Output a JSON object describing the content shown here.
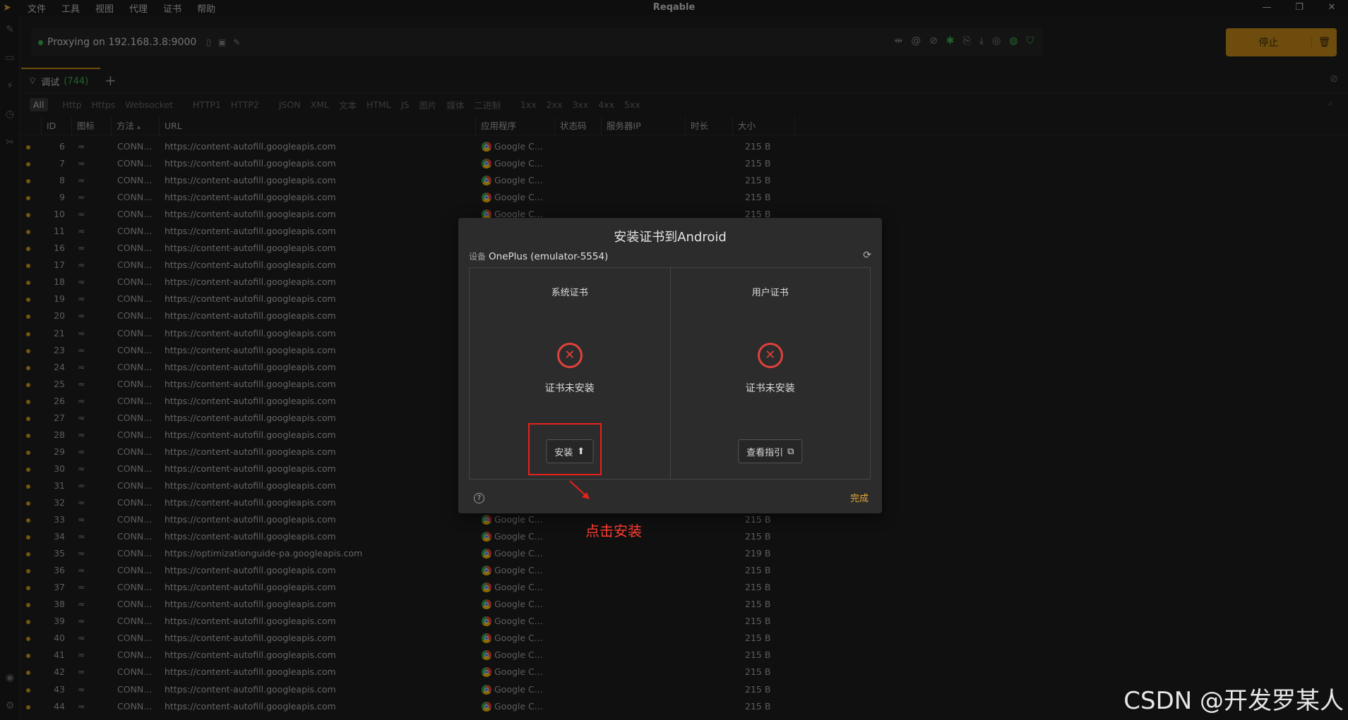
{
  "app": {
    "title": "Reqable",
    "menu": [
      "文件",
      "工具",
      "视图",
      "代理",
      "证书",
      "帮助"
    ]
  },
  "proxy": {
    "status": "Proxying on 192.168.3.8:9000",
    "stop_label": "停止"
  },
  "tabs": [
    {
      "label": "调试",
      "count": "(744)"
    }
  ],
  "filters": [
    "All",
    "Http",
    "Https",
    "Websocket",
    "HTTP1",
    "HTTP2",
    "JSON",
    "XML",
    "文本",
    "HTML",
    "JS",
    "图片",
    "媒体",
    "二进制",
    "1xx",
    "2xx",
    "3xx",
    "4xx",
    "5xx"
  ],
  "columns": {
    "id": "ID",
    "icon": "图标",
    "method": "方法",
    "url": "URL",
    "app": "应用程序",
    "status": "状态码",
    "server_ip": "服务器IP",
    "duration": "时长",
    "size": "大小"
  },
  "rows": [
    {
      "id": "6",
      "method": "CONN...",
      "url": "https://content-autofill.googleapis.com",
      "app": "Google C...",
      "size": "215 B"
    },
    {
      "id": "7",
      "method": "CONN...",
      "url": "https://content-autofill.googleapis.com",
      "app": "Google C...",
      "size": "215 B"
    },
    {
      "id": "8",
      "method": "CONN...",
      "url": "https://content-autofill.googleapis.com",
      "app": "Google C...",
      "size": "215 B"
    },
    {
      "id": "9",
      "method": "CONN...",
      "url": "https://content-autofill.googleapis.com",
      "app": "Google C...",
      "size": "215 B"
    },
    {
      "id": "10",
      "method": "CONN...",
      "url": "https://content-autofill.googleapis.com",
      "app": "Google C...",
      "size": "215 B"
    },
    {
      "id": "11",
      "method": "CONN...",
      "url": "https://content-autofill.googleapis.com",
      "app": "",
      "size": ""
    },
    {
      "id": "16",
      "method": "CONN...",
      "url": "https://content-autofill.googleapis.com",
      "app": "",
      "size": ""
    },
    {
      "id": "17",
      "method": "CONN...",
      "url": "https://content-autofill.googleapis.com",
      "app": "",
      "size": ""
    },
    {
      "id": "18",
      "method": "CONN...",
      "url": "https://content-autofill.googleapis.com",
      "app": "",
      "size": ""
    },
    {
      "id": "19",
      "method": "CONN...",
      "url": "https://content-autofill.googleapis.com",
      "app": "",
      "size": ""
    },
    {
      "id": "20",
      "method": "CONN...",
      "url": "https://content-autofill.googleapis.com",
      "app": "",
      "size": ""
    },
    {
      "id": "21",
      "method": "CONN...",
      "url": "https://content-autofill.googleapis.com",
      "app": "",
      "size": ""
    },
    {
      "id": "23",
      "method": "CONN...",
      "url": "https://content-autofill.googleapis.com",
      "app": "",
      "size": ""
    },
    {
      "id": "24",
      "method": "CONN...",
      "url": "https://content-autofill.googleapis.com",
      "app": "",
      "size": ""
    },
    {
      "id": "25",
      "method": "CONN...",
      "url": "https://content-autofill.googleapis.com",
      "app": "",
      "size": ""
    },
    {
      "id": "26",
      "method": "CONN...",
      "url": "https://content-autofill.googleapis.com",
      "app": "",
      "size": ""
    },
    {
      "id": "27",
      "method": "CONN...",
      "url": "https://content-autofill.googleapis.com",
      "app": "",
      "size": ""
    },
    {
      "id": "28",
      "method": "CONN...",
      "url": "https://content-autofill.googleapis.com",
      "app": "",
      "size": ""
    },
    {
      "id": "29",
      "method": "CONN...",
      "url": "https://content-autofill.googleapis.com",
      "app": "",
      "size": ""
    },
    {
      "id": "30",
      "method": "CONN...",
      "url": "https://content-autofill.googleapis.com",
      "app": "",
      "size": ""
    },
    {
      "id": "31",
      "method": "CONN...",
      "url": "https://content-autofill.googleapis.com",
      "app": "",
      "size": ""
    },
    {
      "id": "32",
      "method": "CONN...",
      "url": "https://content-autofill.googleapis.com",
      "app": "",
      "size": ""
    },
    {
      "id": "33",
      "method": "CONN...",
      "url": "https://content-autofill.googleapis.com",
      "app": "Google C...",
      "size": "215 B"
    },
    {
      "id": "34",
      "method": "CONN...",
      "url": "https://content-autofill.googleapis.com",
      "app": "Google C...",
      "size": "215 B"
    },
    {
      "id": "35",
      "method": "CONN...",
      "url": "https://optimizationguide-pa.googleapis.com",
      "app": "Google C...",
      "size": "219 B"
    },
    {
      "id": "36",
      "method": "CONN...",
      "url": "https://content-autofill.googleapis.com",
      "app": "Google C...",
      "size": "215 B"
    },
    {
      "id": "37",
      "method": "CONN...",
      "url": "https://content-autofill.googleapis.com",
      "app": "Google C...",
      "size": "215 B"
    },
    {
      "id": "38",
      "method": "CONN...",
      "url": "https://content-autofill.googleapis.com",
      "app": "Google C...",
      "size": "215 B"
    },
    {
      "id": "39",
      "method": "CONN...",
      "url": "https://content-autofill.googleapis.com",
      "app": "Google C...",
      "size": "215 B"
    },
    {
      "id": "40",
      "method": "CONN...",
      "url": "https://content-autofill.googleapis.com",
      "app": "Google C...",
      "size": "215 B"
    },
    {
      "id": "41",
      "method": "CONN...",
      "url": "https://content-autofill.googleapis.com",
      "app": "Google C...",
      "size": "215 B"
    },
    {
      "id": "42",
      "method": "CONN...",
      "url": "https://content-autofill.googleapis.com",
      "app": "Google C...",
      "size": "215 B"
    },
    {
      "id": "43",
      "method": "CONN...",
      "url": "https://content-autofill.googleapis.com",
      "app": "Google C...",
      "size": "215 B"
    },
    {
      "id": "44",
      "method": "CONN...",
      "url": "https://content-autofill.googleapis.com",
      "app": "Google C...",
      "size": "215 B"
    }
  ],
  "dialog": {
    "title": "安装证书到Android",
    "device_label": "设备",
    "device_name": "OnePlus (emulator-5554)",
    "system_cert": {
      "title": "系统证书",
      "status": "证书未安装",
      "button": "安装"
    },
    "user_cert": {
      "title": "用户证书",
      "status": "证书未安装",
      "button": "查看指引"
    },
    "done": "完成"
  },
  "annotation": {
    "callout": "点击安装"
  },
  "watermark": "CSDN @开发罗某人",
  "colors": {
    "accent": "#c98a1a",
    "status_dot": "#d2a114",
    "error": "#e0413b",
    "highlight": "#e5221b"
  }
}
